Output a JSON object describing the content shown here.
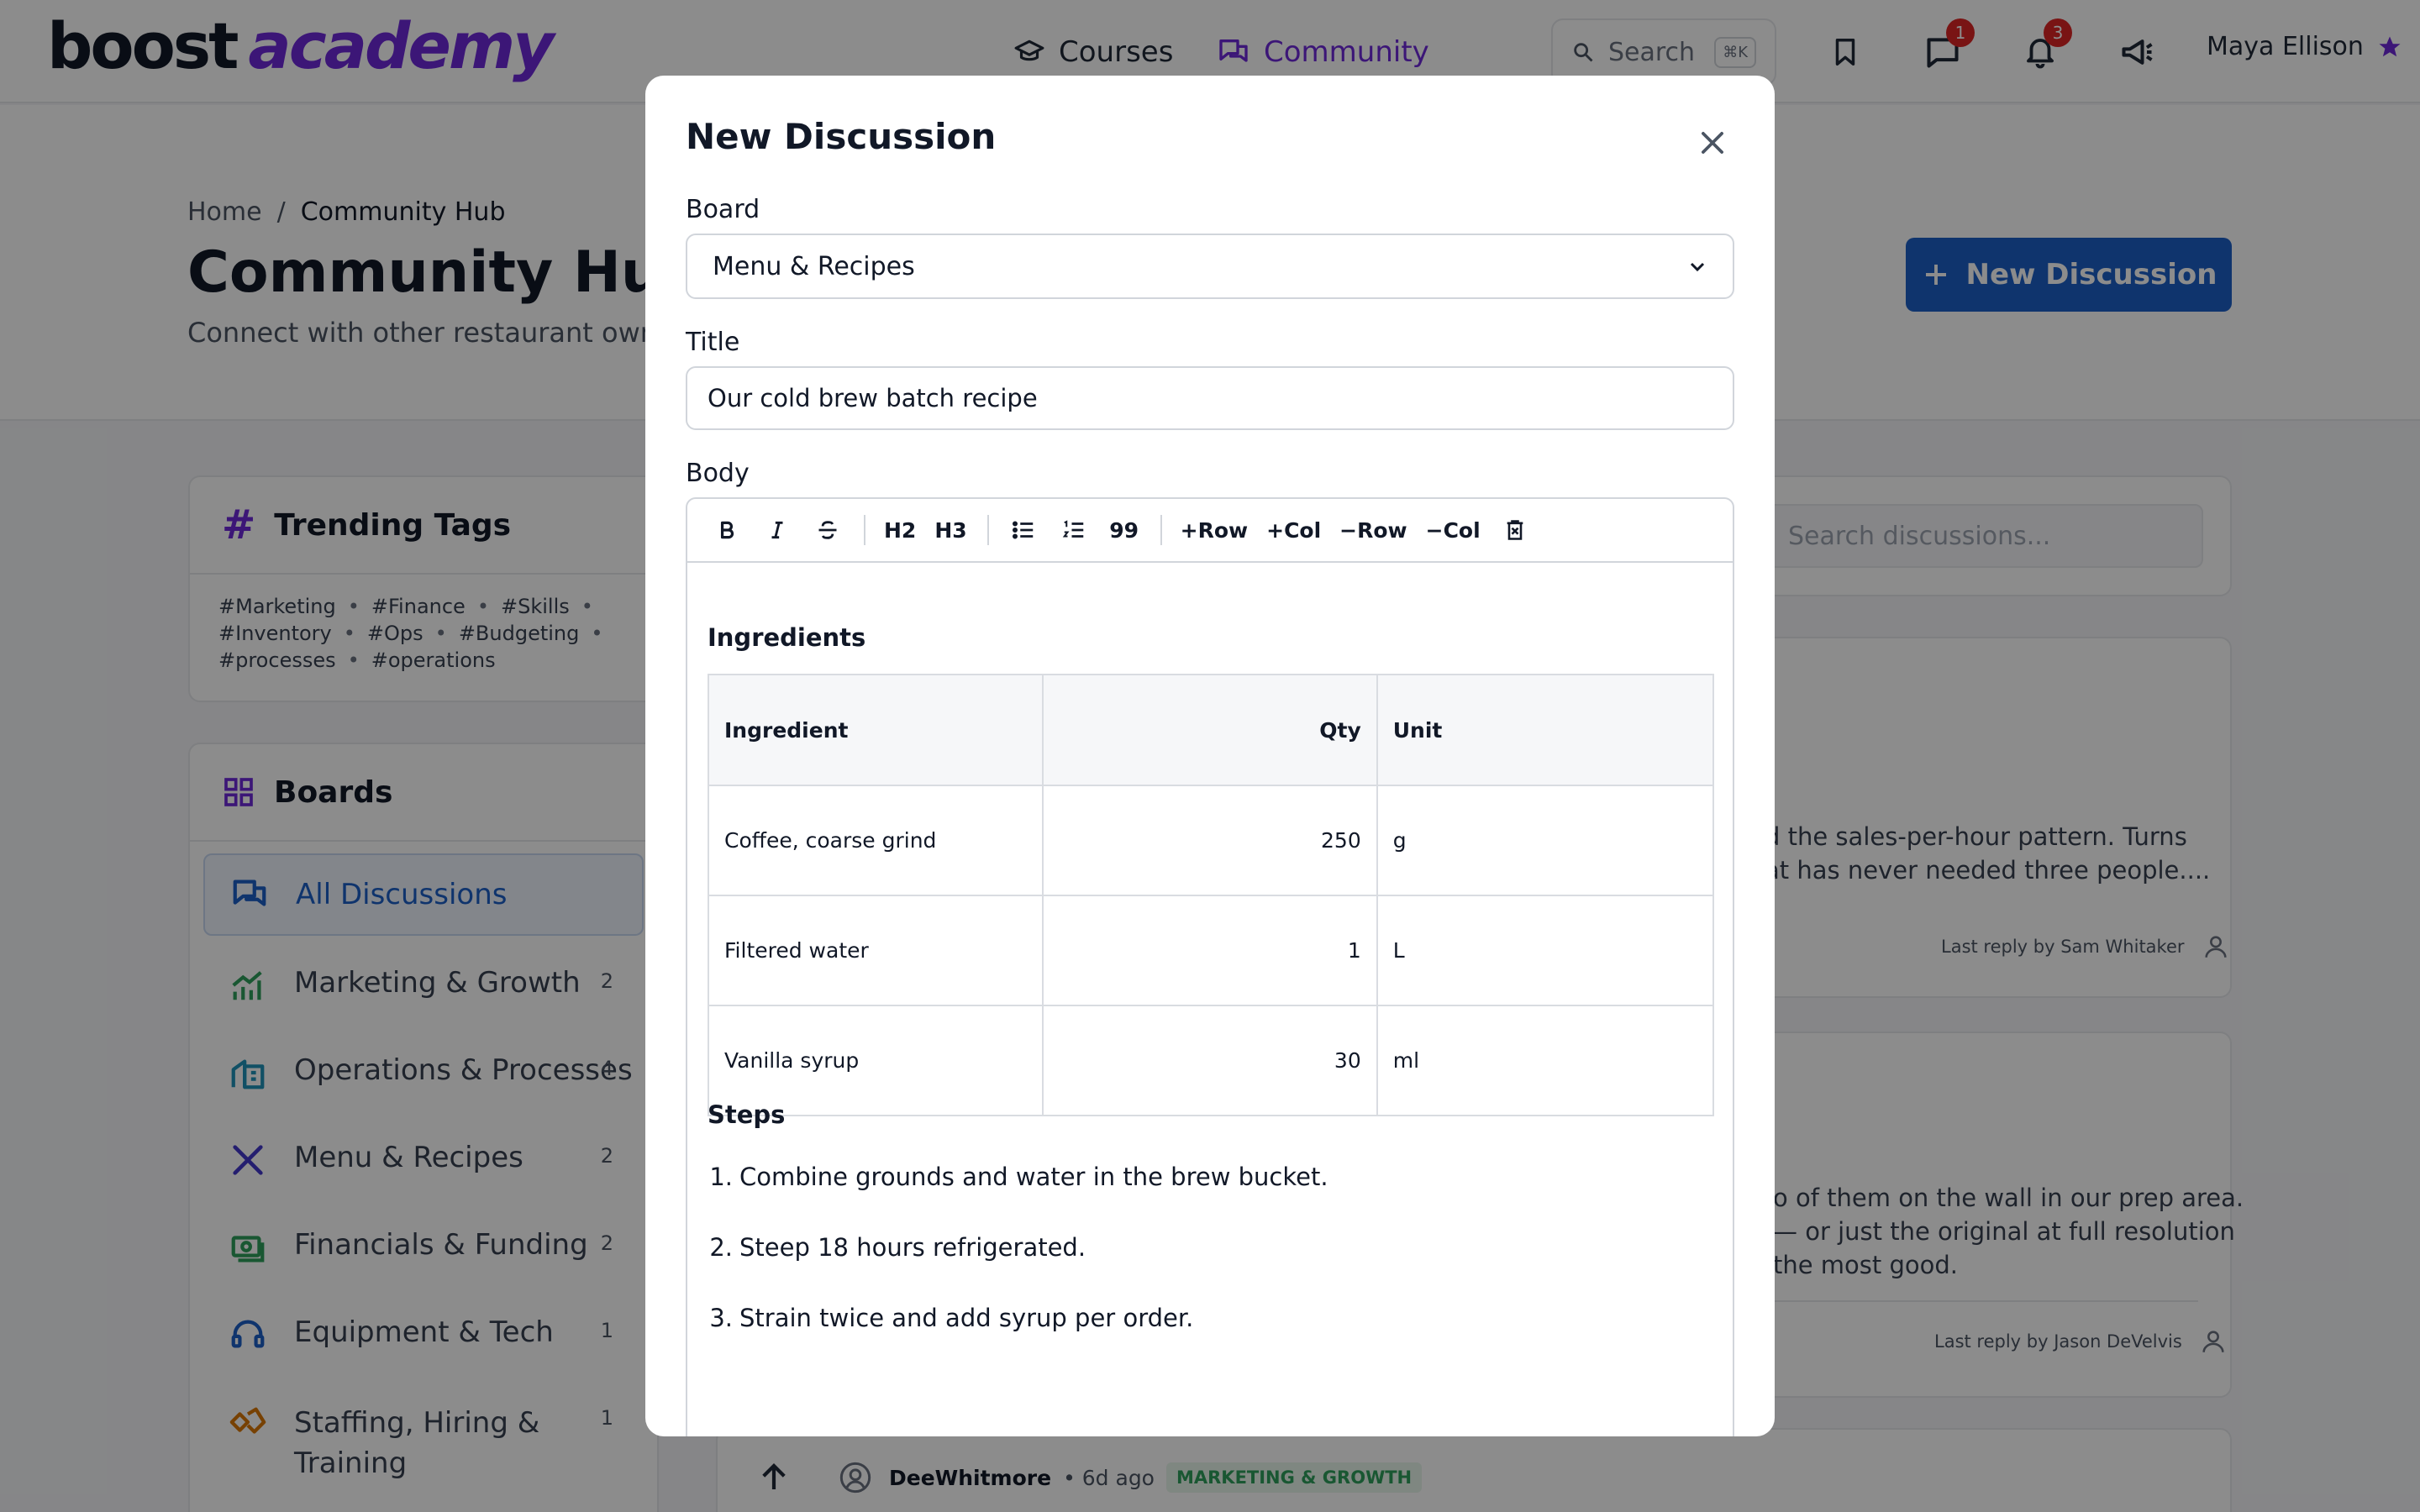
{
  "brand": {
    "boost": "boost",
    "academy": "academy"
  },
  "nav": {
    "courses": "Courses",
    "community": "Community"
  },
  "search": {
    "placeholder": "Search",
    "shortcut": "⌘K"
  },
  "badges": {
    "messages": "1",
    "notifications": "3"
  },
  "user": {
    "name": "Maya Ellison"
  },
  "breadcrumb": {
    "home": "Home",
    "separator": "/",
    "current": "Community Hub"
  },
  "page": {
    "title": "Community Hub",
    "subtitle": "Connect with other restaurant owners",
    "new_discussion": "New Discussion"
  },
  "trending": {
    "title": "Trending Tags",
    "tags": [
      "#Marketing",
      "#Finance",
      "#Skills",
      "#Inventory",
      "#Ops",
      "#Budgeting",
      "#processes",
      "#operations"
    ]
  },
  "boards": {
    "title": "Boards",
    "items": [
      {
        "label": "All Discussions",
        "count": ""
      },
      {
        "label": "Marketing & Growth",
        "count": "2"
      },
      {
        "label": "Operations & Processes",
        "count": "4"
      },
      {
        "label": "Menu & Recipes",
        "count": "2"
      },
      {
        "label": "Financials & Funding",
        "count": "2"
      },
      {
        "label": "Equipment & Tech",
        "count": "1"
      },
      {
        "label": "Staffing, Hiring & Training",
        "count": "1"
      }
    ]
  },
  "discussions": {
    "search_placeholder": "Search discussions...",
    "card1": {
      "line1": "d the sales-per-hour pattern. Turns",
      "line2": "at has never needed three people....",
      "last_reply": "Last reply by Sam Whitaker"
    },
    "card2": {
      "line1": "o of them on the wall in our prep area.",
      "line2": "— or just the original at full resolution",
      "line3": "the most good.",
      "last_reply": "Last reply by Jason DeVelvis"
    },
    "card3": {
      "author": "DeeWhitmore",
      "ago": "• 6d ago",
      "board": "MARKETING & GROWTH"
    }
  },
  "modal": {
    "title": "New Discussion",
    "board_label": "Board",
    "board_value": "Menu & Recipes",
    "title_label": "Title",
    "title_value": "Our cold brew batch recipe",
    "body_label": "Body",
    "toolbar": {
      "h2": "H2",
      "h3": "H3",
      "quote": "99",
      "add_row": "+Row",
      "add_col": "+Col",
      "del_row": "−Row",
      "del_col": "−Col"
    },
    "body": {
      "ingredients_heading": "Ingredients",
      "table_headers": [
        "Ingredient",
        "Qty",
        "Unit"
      ],
      "table_rows": [
        [
          "Coffee, coarse grind",
          "250",
          "g"
        ],
        [
          "Filtered water",
          "1",
          "L"
        ],
        [
          "Vanilla syrup",
          "30",
          "ml"
        ]
      ],
      "steps_heading": "Steps",
      "steps": [
        "Combine grounds and water in the brew bucket.",
        "Steep 18 hours refrigerated.",
        "Strain twice and add syrup per order."
      ]
    }
  },
  "colors": {
    "brand_purple": "#6d28d9",
    "primary_blue": "#1d5fc7",
    "board_green": "#2f9e5b"
  }
}
